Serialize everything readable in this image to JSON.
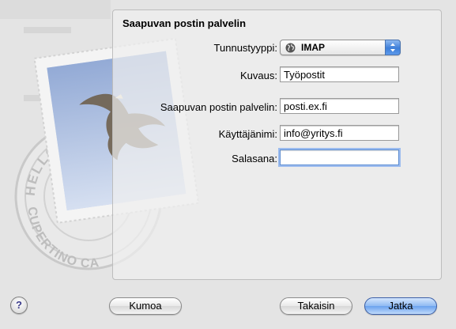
{
  "panel_title": "Saapuvan postin palvelin",
  "form": {
    "account_type_label": "Tunnustyyppi:",
    "account_type_value": "IMAP",
    "description_label": "Kuvaus:",
    "description_value": "Työpostit",
    "server_label": "Saapuvan postin palvelin:",
    "server_value": "posti.ex.fi",
    "username_label": "Käyttäjänimi:",
    "username_value": "info@yritys.fi",
    "password_label": "Salasana:",
    "password_value": ""
  },
  "buttons": {
    "help": "?",
    "cancel": "Kumoa",
    "back": "Takaisin",
    "continue": "Jatka"
  },
  "stamp": {
    "top_text": "HELLO FR",
    "bottom_text": "CUPERTINO CA"
  },
  "icons": {
    "background": "mail-stamp-icon",
    "popup": "globe-icon",
    "popup_arrows": "up-down-arrows-icon"
  },
  "colors": {
    "default_button": "#6aa2ee",
    "focus_ring": "#9cbcef",
    "popup_arrows": "#3e7fd9"
  }
}
